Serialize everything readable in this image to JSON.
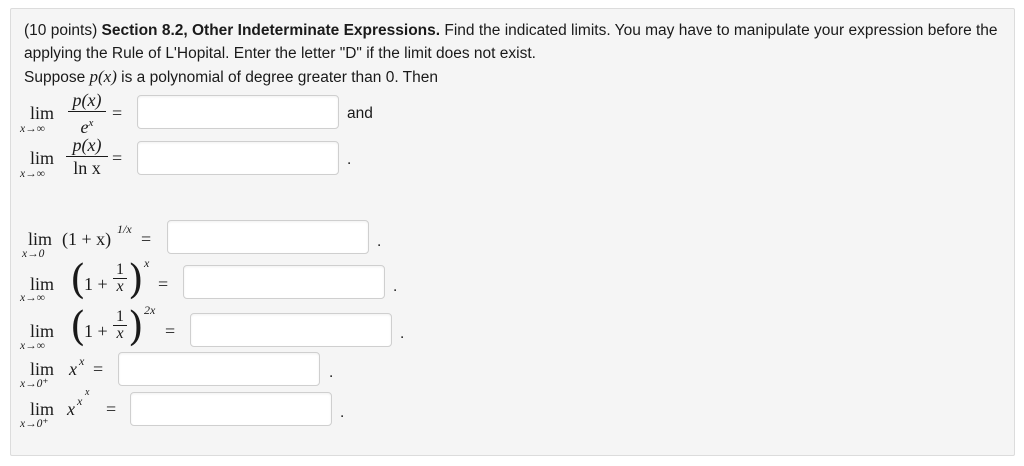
{
  "problem": {
    "points": "(10 points) ",
    "section": "Section 8.2, Other Indeterminate Expressions.",
    "instructions": " Find the indicated limits. You may have to manipulate your expression before the applying the Rule of L'Hopital. Enter the letter \"D\" if the limit does not exist.",
    "suppose_prefix": "Suppose ",
    "suppose_px": "p(x)",
    "suppose_suffix": " is a polynomial of degree greater than 0. Then"
  },
  "math": {
    "lim": "lim",
    "eq": "=",
    "px": "p(x)",
    "e": "e",
    "x": "x",
    "lnx": "ln x",
    "one_plus_x": "(1 + x)",
    "exp_1_over_x": "1/x",
    "one_plus": "1 +",
    "one": "1",
    "exp_x": "x",
    "exp_2x": "2x",
    "x_pow_x": "x",
    "sub_inf": "x→∞",
    "sub_zero": "x→0",
    "sub_zero_plus": "x→0⁺"
  },
  "rows": [
    {
      "tail": "and",
      "value": ""
    },
    {
      "tail": ".",
      "value": ""
    },
    {
      "tail": ".",
      "value": ""
    },
    {
      "tail": ".",
      "value": ""
    },
    {
      "tail": ".",
      "value": ""
    },
    {
      "tail": ".",
      "value": ""
    },
    {
      "tail": ".",
      "value": ""
    }
  ]
}
